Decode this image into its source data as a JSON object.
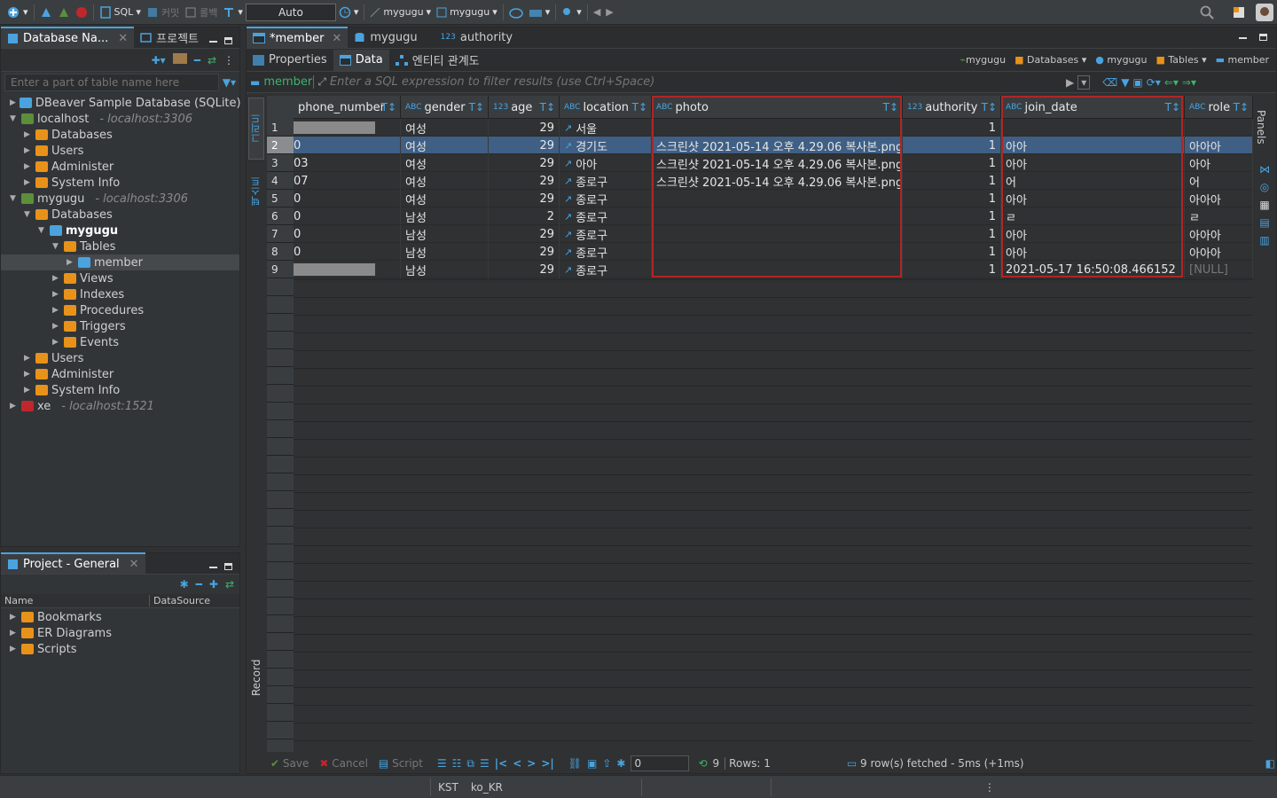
{
  "toolbar": {
    "sql_label": "SQL",
    "commit_label": "커밋",
    "rollback_label": "롤백",
    "tx_mode": "Auto",
    "datasource": "mygugu",
    "schema": "mygugu"
  },
  "db_navigator": {
    "tab_label": "Database Na...",
    "tab2_label": "프로젝트",
    "filter_placeholder": "Enter a part of table name here",
    "tree": [
      {
        "label": "DBeaver Sample Database (SQLite)",
        "sub": ""
      },
      {
        "label": "localhost",
        "sub": "- localhost:3306"
      },
      {
        "label": "Databases",
        "sub": ""
      },
      {
        "label": "Users",
        "sub": ""
      },
      {
        "label": "Administer",
        "sub": ""
      },
      {
        "label": "System Info",
        "sub": ""
      },
      {
        "label": "mygugu",
        "sub": "- localhost:3306"
      },
      {
        "label": "Databases",
        "sub": ""
      },
      {
        "label": "mygugu",
        "sub": ""
      },
      {
        "label": "Tables",
        "sub": ""
      },
      {
        "label": "member",
        "sub": ""
      },
      {
        "label": "Views",
        "sub": ""
      },
      {
        "label": "Indexes",
        "sub": ""
      },
      {
        "label": "Procedures",
        "sub": ""
      },
      {
        "label": "Triggers",
        "sub": ""
      },
      {
        "label": "Events",
        "sub": ""
      },
      {
        "label": "Users",
        "sub": ""
      },
      {
        "label": "Administer",
        "sub": ""
      },
      {
        "label": "System Info",
        "sub": ""
      },
      {
        "label": "xe",
        "sub": "- localhost:1521"
      }
    ]
  },
  "project_panel": {
    "tab_label": "Project - General",
    "col_name": "Name",
    "col_datasource": "DataSource",
    "items": [
      "Bookmarks",
      "ER Diagrams",
      "Scripts"
    ]
  },
  "editor": {
    "tabs": [
      "*member",
      "mygugu",
      "authority"
    ],
    "tab3_type": "123",
    "subtabs": [
      "Properties",
      "Data",
      "엔티티 관계도"
    ],
    "breadcrumb": [
      "mygugu",
      "Databases",
      "mygugu",
      "Tables",
      "member"
    ],
    "filter_table": "member",
    "filter_placeholder": "Enter a SQL expression to filter results (use Ctrl+Space)",
    "side_grid": "그리드",
    "side_text": "텍스트",
    "side_record": "Record",
    "panels_label": "Panels"
  },
  "grid": {
    "columns": [
      {
        "name": "phone_number",
        "type": ""
      },
      {
        "name": "gender",
        "type": "ABC"
      },
      {
        "name": "age",
        "type": "123"
      },
      {
        "name": "location",
        "type": "ABC"
      },
      {
        "name": "photo",
        "type": "ABC"
      },
      {
        "name": "authority",
        "type": "123"
      },
      {
        "name": "join_date",
        "type": "ABC"
      },
      {
        "name": "role",
        "type": "ABC"
      }
    ],
    "rows": [
      {
        "n": "1",
        "phone": "",
        "gender": "여성",
        "age": "29",
        "location": "서울",
        "photo": "",
        "authority": "1",
        "join_date": "",
        "role": ""
      },
      {
        "n": "2",
        "phone": "0",
        "gender": "여성",
        "age": "29",
        "location": "경기도",
        "photo": "스크린샷 2021-05-14 오후 4.29.06 복사본.png",
        "authority": "1",
        "join_date": "아아",
        "role": "아아아"
      },
      {
        "n": "3",
        "phone": "03",
        "gender": "여성",
        "age": "29",
        "location": "아아",
        "photo": "스크린샷 2021-05-14 오후 4.29.06 복사본.png",
        "authority": "1",
        "join_date": "아아",
        "role": "아아"
      },
      {
        "n": "4",
        "phone": "07",
        "gender": "여성",
        "age": "29",
        "location": "종로구",
        "photo": "스크린샷 2021-05-14 오후 4.29.06 복사본.png",
        "authority": "1",
        "join_date": "어",
        "role": "어"
      },
      {
        "n": "5",
        "phone": "0",
        "gender": "여성",
        "age": "29",
        "location": "종로구",
        "photo": "",
        "authority": "1",
        "join_date": "아아",
        "role": "아아아"
      },
      {
        "n": "6",
        "phone": "0",
        "gender": "남성",
        "age": "2",
        "location": "종로구",
        "photo": "",
        "authority": "1",
        "join_date": "ㄹ",
        "role": "ㄹ"
      },
      {
        "n": "7",
        "phone": "0",
        "gender": "남성",
        "age": "29",
        "location": "종로구",
        "photo": "",
        "authority": "1",
        "join_date": "아아",
        "role": "아아아"
      },
      {
        "n": "8",
        "phone": "0",
        "gender": "남성",
        "age": "29",
        "location": "종로구",
        "photo": "",
        "authority": "1",
        "join_date": "아아",
        "role": "아아아"
      },
      {
        "n": "9",
        "phone": "",
        "gender": "남성",
        "age": "29",
        "location": "종로구",
        "photo": "",
        "authority": "1",
        "join_date": "2021-05-17 16:50:08.466152",
        "role": "[NULL]"
      }
    ]
  },
  "bottom": {
    "save": "Save",
    "cancel": "Cancel",
    "script": "Script",
    "page_input": "0",
    "count": "9",
    "rows_label": "Rows: 1",
    "fetch_status": "9 row(s) fetched - 5ms (+1ms)"
  },
  "statusbar": {
    "timezone": "KST",
    "locale": "ko_KR"
  },
  "colors": {
    "accent": "#4aa3df",
    "folder": "#e8921a",
    "selection": "#3f5f85",
    "highlight_box": "#b02626"
  }
}
